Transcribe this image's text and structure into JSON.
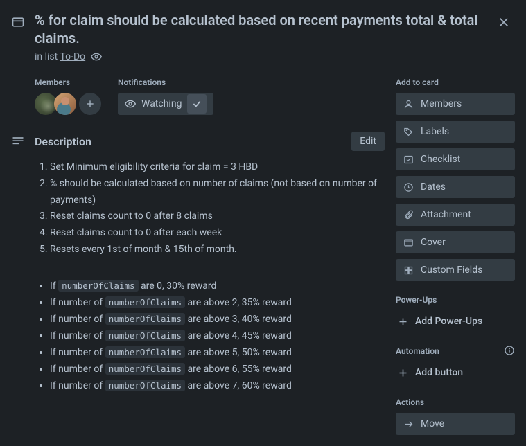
{
  "title": "% for claim should be calculated based on recent payments total & total claims.",
  "list_prefix": "in list",
  "list_name": "To-Do",
  "members_label": "Members",
  "notifications_label": "Notifications",
  "watching_label": "Watching",
  "description_label": "Description",
  "edit_label": "Edit",
  "ol": [
    "Set Minimum eligibility criteria for claim = 3 HBD",
    "% should be calculated based on number of claims (not based on number of payments)",
    "Reset claims count to 0 after 8 claims",
    "Reset claims count to 0 after each week",
    "Resets every 1st of month & 15th of month."
  ],
  "ul": [
    {
      "a": "If ",
      "c": "numberOfClaims",
      "b": " are 0, 30% reward"
    },
    {
      "a": "If number of ",
      "c": "numberOfClaims",
      "b": " are above 2, 35% reward"
    },
    {
      "a": "If number of ",
      "c": "numberOfClaims",
      "b": " are above 3, 40% reward"
    },
    {
      "a": "If number of ",
      "c": "numberOfClaims",
      "b": " are above 4, 45% reward"
    },
    {
      "a": "If number of ",
      "c": "numberOfClaims",
      "b": " are above 5, 50% reward"
    },
    {
      "a": "If number of ",
      "c": "numberOfClaims",
      "b": " are above 6, 55% reward"
    },
    {
      "a": "If number of ",
      "c": "numberOfClaims",
      "b": " are above 7, 60% reward"
    }
  ],
  "side": {
    "add_to_card": "Add to card",
    "members": "Members",
    "labels": "Labels",
    "checklist": "Checklist",
    "dates": "Dates",
    "attachment": "Attachment",
    "cover": "Cover",
    "custom_fields": "Custom Fields",
    "powerups": "Power-Ups",
    "add_powerups": "Add Power-Ups",
    "automation": "Automation",
    "add_button": "Add button",
    "actions": "Actions",
    "move": "Move"
  }
}
